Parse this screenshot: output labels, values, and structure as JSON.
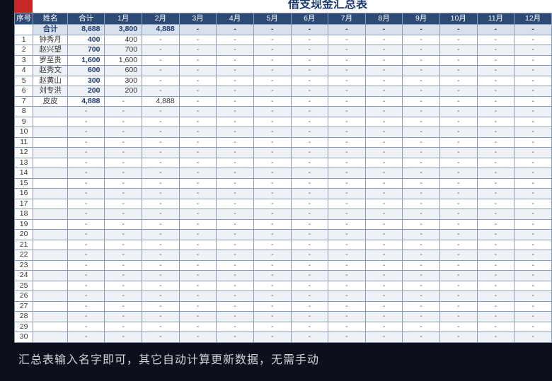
{
  "chart_data": {
    "type": "table",
    "title": "借支现金汇总表",
    "columns": [
      "序号",
      "姓名",
      "合计",
      "1月",
      "2月",
      "3月",
      "4月",
      "5月",
      "6月",
      "7月",
      "8月",
      "9月",
      "10月",
      "11月",
      "12月"
    ],
    "totals": {
      "name": "合计",
      "total": "8,688",
      "months": [
        "3,800",
        "4,888",
        "-",
        "-",
        "-",
        "-",
        "-",
        "-",
        "-",
        "-",
        "-",
        "-"
      ]
    },
    "rows": [
      {
        "idx": "1",
        "name": "钟秀月",
        "total": "400",
        "months": [
          "400",
          "-",
          "-",
          "-",
          "-",
          "-",
          "-",
          "-",
          "-",
          "-",
          "-",
          "-"
        ]
      },
      {
        "idx": "2",
        "name": "赵兴望",
        "total": "700",
        "months": [
          "700",
          "-",
          "-",
          "-",
          "-",
          "-",
          "-",
          "-",
          "-",
          "-",
          "-",
          "-"
        ]
      },
      {
        "idx": "3",
        "name": "罗至贵",
        "total": "1,600",
        "months": [
          "1,600",
          "-",
          "-",
          "-",
          "-",
          "-",
          "-",
          "-",
          "-",
          "-",
          "-",
          "-"
        ]
      },
      {
        "idx": "4",
        "name": "赵秀文",
        "total": "600",
        "months": [
          "600",
          "-",
          "-",
          "-",
          "-",
          "-",
          "-",
          "-",
          "-",
          "-",
          "-",
          "-"
        ]
      },
      {
        "idx": "5",
        "name": "赵黄山",
        "total": "300",
        "months": [
          "300",
          "-",
          "-",
          "-",
          "-",
          "-",
          "-",
          "-",
          "-",
          "-",
          "-",
          "-"
        ]
      },
      {
        "idx": "6",
        "name": "刘专洪",
        "total": "200",
        "months": [
          "200",
          "-",
          "-",
          "-",
          "-",
          "-",
          "-",
          "-",
          "-",
          "-",
          "-",
          "-"
        ]
      },
      {
        "idx": "7",
        "name": "皮皮",
        "total": "4,888",
        "months": [
          "-",
          "4,888",
          "-",
          "-",
          "-",
          "-",
          "-",
          "-",
          "-",
          "-",
          "-",
          "-"
        ]
      },
      {
        "idx": "8",
        "name": "",
        "total": "-",
        "months": [
          "-",
          "-",
          "-",
          "-",
          "-",
          "-",
          "-",
          "-",
          "-",
          "-",
          "-",
          "-"
        ]
      },
      {
        "idx": "9",
        "name": "",
        "total": "-",
        "months": [
          "-",
          "-",
          "-",
          "-",
          "-",
          "-",
          "-",
          "-",
          "-",
          "-",
          "-",
          "-"
        ]
      },
      {
        "idx": "10",
        "name": "",
        "total": "-",
        "months": [
          "-",
          "-",
          "-",
          "-",
          "-",
          "-",
          "-",
          "-",
          "-",
          "-",
          "-",
          "-"
        ]
      },
      {
        "idx": "11",
        "name": "",
        "total": "-",
        "months": [
          "-",
          "-",
          "-",
          "-",
          "-",
          "-",
          "-",
          "-",
          "-",
          "-",
          "-",
          "-"
        ]
      },
      {
        "idx": "12",
        "name": "",
        "total": "-",
        "months": [
          "-",
          "-",
          "-",
          "-",
          "-",
          "-",
          "-",
          "-",
          "-",
          "-",
          "-",
          "-"
        ]
      },
      {
        "idx": "13",
        "name": "",
        "total": "-",
        "months": [
          "-",
          "-",
          "-",
          "-",
          "-",
          "-",
          "-",
          "-",
          "-",
          "-",
          "-",
          "-"
        ]
      },
      {
        "idx": "14",
        "name": "",
        "total": "-",
        "months": [
          "-",
          "-",
          "-",
          "-",
          "-",
          "-",
          "-",
          "-",
          "-",
          "-",
          "-",
          "-"
        ]
      },
      {
        "idx": "15",
        "name": "",
        "total": "-",
        "months": [
          "-",
          "-",
          "-",
          "-",
          "-",
          "-",
          "-",
          "-",
          "-",
          "-",
          "-",
          "-"
        ]
      },
      {
        "idx": "16",
        "name": "",
        "total": "-",
        "months": [
          "-",
          "-",
          "-",
          "-",
          "-",
          "-",
          "-",
          "-",
          "-",
          "-",
          "-",
          "-"
        ]
      },
      {
        "idx": "17",
        "name": "",
        "total": "-",
        "months": [
          "-",
          "-",
          "-",
          "-",
          "-",
          "-",
          "-",
          "-",
          "-",
          "-",
          "-",
          "-"
        ]
      },
      {
        "idx": "18",
        "name": "",
        "total": "-",
        "months": [
          "-",
          "-",
          "-",
          "-",
          "-",
          "-",
          "-",
          "-",
          "-",
          "-",
          "-",
          "-"
        ]
      },
      {
        "idx": "19",
        "name": "",
        "total": "-",
        "months": [
          "-",
          "-",
          "-",
          "-",
          "-",
          "-",
          "-",
          "-",
          "-",
          "-",
          "-",
          "-"
        ]
      },
      {
        "idx": "20",
        "name": "",
        "total": "-",
        "months": [
          "-",
          "-",
          "-",
          "-",
          "-",
          "-",
          "-",
          "-",
          "-",
          "-",
          "-",
          "-"
        ]
      },
      {
        "idx": "21",
        "name": "",
        "total": "-",
        "months": [
          "-",
          "-",
          "-",
          "-",
          "-",
          "-",
          "-",
          "-",
          "-",
          "-",
          "-",
          "-"
        ]
      },
      {
        "idx": "22",
        "name": "",
        "total": "-",
        "months": [
          "-",
          "-",
          "-",
          "-",
          "-",
          "-",
          "-",
          "-",
          "-",
          "-",
          "-",
          "-"
        ]
      },
      {
        "idx": "23",
        "name": "",
        "total": "-",
        "months": [
          "-",
          "-",
          "-",
          "-",
          "-",
          "-",
          "-",
          "-",
          "-",
          "-",
          "-",
          "-"
        ]
      },
      {
        "idx": "24",
        "name": "",
        "total": "-",
        "months": [
          "-",
          "-",
          "-",
          "-",
          "-",
          "-",
          "-",
          "-",
          "-",
          "-",
          "-",
          "-"
        ]
      },
      {
        "idx": "25",
        "name": "",
        "total": "-",
        "months": [
          "-",
          "-",
          "-",
          "-",
          "-",
          "-",
          "-",
          "-",
          "-",
          "-",
          "-",
          "-"
        ]
      },
      {
        "idx": "26",
        "name": "",
        "total": "-",
        "months": [
          "-",
          "-",
          "-",
          "-",
          "-",
          "-",
          "-",
          "-",
          "-",
          "-",
          "-",
          "-"
        ]
      },
      {
        "idx": "27",
        "name": "",
        "total": "-",
        "months": [
          "-",
          "-",
          "-",
          "-",
          "-",
          "-",
          "-",
          "-",
          "-",
          "-",
          "-",
          "-"
        ]
      },
      {
        "idx": "28",
        "name": "",
        "total": "-",
        "months": [
          "-",
          "-",
          "-",
          "-",
          "-",
          "-",
          "-",
          "-",
          "-",
          "-",
          "-",
          "-"
        ]
      },
      {
        "idx": "29",
        "name": "",
        "total": "-",
        "months": [
          "-",
          "-",
          "-",
          "-",
          "-",
          "-",
          "-",
          "-",
          "-",
          "-",
          "-",
          "-"
        ]
      },
      {
        "idx": "30",
        "name": "",
        "total": "-",
        "months": [
          "-",
          "-",
          "-",
          "-",
          "-",
          "-",
          "-",
          "-",
          "-",
          "-",
          "-",
          "-"
        ]
      }
    ]
  },
  "footer": "汇总表输入名字即可，其它自动计算更新数据，无需手动"
}
